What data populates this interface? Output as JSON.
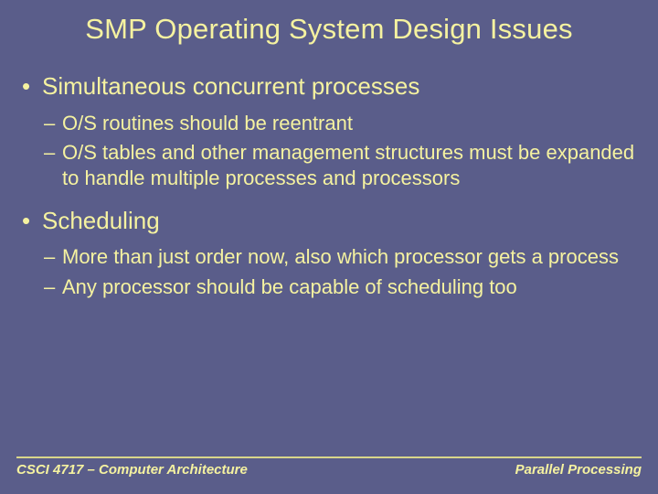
{
  "title": "SMP Operating System Design Issues",
  "sections": [
    {
      "heading": "Simultaneous concurrent processes",
      "items": [
        "O/S routines should be reentrant",
        "O/S tables and other management structures must be expanded to handle multiple processes and processors"
      ]
    },
    {
      "heading": "Scheduling",
      "items": [
        "More than just order now, also which processor gets a process",
        "Any processor should be capable of scheduling too"
      ]
    }
  ],
  "footer": {
    "left": "CSCI 4717 – Computer Architecture",
    "right": "Parallel Processing"
  }
}
